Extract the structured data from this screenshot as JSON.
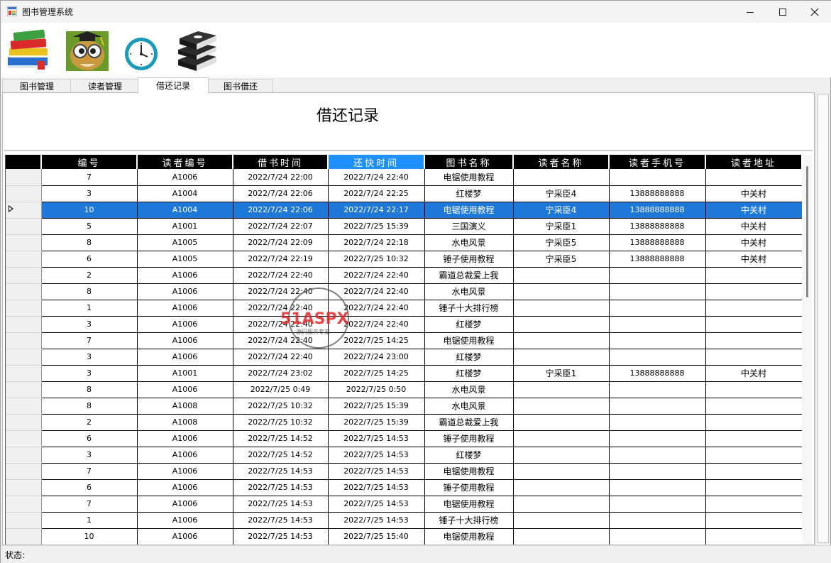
{
  "window": {
    "title": "图书管理系统"
  },
  "toolbar": {
    "icons": [
      "books-icon",
      "owl-graduate-icon",
      "clock-icon",
      "stack-books-icon"
    ]
  },
  "tabs": [
    {
      "label": "图书管理",
      "active": false
    },
    {
      "label": "读者管理",
      "active": false
    },
    {
      "label": "借还记录",
      "active": true
    },
    {
      "label": "图书借还",
      "active": false
    }
  ],
  "panel": {
    "title": "借还记录"
  },
  "grid": {
    "columns": [
      "编号",
      "读者编号",
      "借书时间",
      "还快时间",
      "图书名称",
      "读者名称",
      "读者手机号",
      "读者地址"
    ],
    "selected_column": 3,
    "selected_row": 2,
    "rows": [
      [
        "7",
        "A1006",
        "2022/7/24 22:00",
        "2022/7/24 22:40",
        "电锯使用教程",
        "",
        "",
        ""
      ],
      [
        "3",
        "A1004",
        "2022/7/24 22:06",
        "2022/7/24 22:25",
        "红楼梦",
        "宁采臣4",
        "13888888888",
        "中关村"
      ],
      [
        "10",
        "A1004",
        "2022/7/24 22:06",
        "2022/7/24 22:17",
        "电锯使用教程",
        "宁采臣4",
        "13888888888",
        "中关村"
      ],
      [
        "5",
        "A1001",
        "2022/7/24 22:07",
        "2022/7/25 15:39",
        "三国演义",
        "宁采臣1",
        "13888888888",
        "中关村"
      ],
      [
        "8",
        "A1005",
        "2022/7/24 22:09",
        "2022/7/24 22:18",
        "水电风景",
        "宁采臣5",
        "13888888888",
        "中关村"
      ],
      [
        "6",
        "A1005",
        "2022/7/24 22:19",
        "2022/7/25 10:32",
        "锤子使用教程",
        "宁采臣5",
        "13888888888",
        "中关村"
      ],
      [
        "2",
        "A1006",
        "2022/7/24 22:40",
        "2022/7/24 22:40",
        "霸道总裁爱上我",
        "",
        "",
        ""
      ],
      [
        "8",
        "A1006",
        "2022/7/24 22:40",
        "2022/7/24 22:40",
        "水电风景",
        "",
        "",
        ""
      ],
      [
        "1",
        "A1006",
        "2022/7/24 22:40",
        "2022/7/24 22:40",
        "锤子十大排行榜",
        "",
        "",
        ""
      ],
      [
        "3",
        "A1006",
        "2022/7/24 22:40",
        "2022/7/24 22:40",
        "红楼梦",
        "",
        "",
        ""
      ],
      [
        "7",
        "A1006",
        "2022/7/24 22:40",
        "2022/7/25 14:25",
        "电锯使用教程",
        "",
        "",
        ""
      ],
      [
        "3",
        "A1006",
        "2022/7/24 22:40",
        "2022/7/24 23:00",
        "红楼梦",
        "",
        "",
        ""
      ],
      [
        "3",
        "A1001",
        "2022/7/24 23:02",
        "2022/7/25 14:25",
        "红楼梦",
        "宁采臣1",
        "13888888888",
        "中关村"
      ],
      [
        "8",
        "A1006",
        "2022/7/25 0:49",
        "2022/7/25 0:50",
        "水电风景",
        "",
        "",
        ""
      ],
      [
        "8",
        "A1008",
        "2022/7/25 10:32",
        "2022/7/25 15:39",
        "水电风景",
        "",
        "",
        ""
      ],
      [
        "2",
        "A1008",
        "2022/7/25 10:32",
        "2022/7/25 15:39",
        "霸道总裁爱上我",
        "",
        "",
        ""
      ],
      [
        "6",
        "A1006",
        "2022/7/25 14:52",
        "2022/7/25 14:53",
        "锤子使用教程",
        "",
        "",
        ""
      ],
      [
        "3",
        "A1006",
        "2022/7/25 14:52",
        "2022/7/25 14:53",
        "红楼梦",
        "",
        "",
        ""
      ],
      [
        "7",
        "A1006",
        "2022/7/25 14:53",
        "2022/7/25 14:53",
        "电锯使用教程",
        "",
        "",
        ""
      ],
      [
        "6",
        "A1006",
        "2022/7/25 14:53",
        "2022/7/25 14:53",
        "锤子使用教程",
        "",
        "",
        ""
      ],
      [
        "7",
        "A1006",
        "2022/7/25 14:53",
        "2022/7/25 14:53",
        "电锯使用教程",
        "",
        "",
        ""
      ],
      [
        "1",
        "A1006",
        "2022/7/25 14:53",
        "2022/7/25 14:53",
        "锤子十大排行榜",
        "",
        "",
        ""
      ],
      [
        "10",
        "A1006",
        "2022/7/25 14:53",
        "2022/7/25 15:40",
        "电锯使用教程",
        "",
        "",
        ""
      ]
    ]
  },
  "status": {
    "label": "状态:"
  },
  "watermark": {
    "brand": "51ASPX",
    "tagline": "源码服务专家"
  },
  "colors": {
    "selection": "#1e78d8",
    "selected_header": "#1e90ff",
    "header_bg": "#000000"
  }
}
